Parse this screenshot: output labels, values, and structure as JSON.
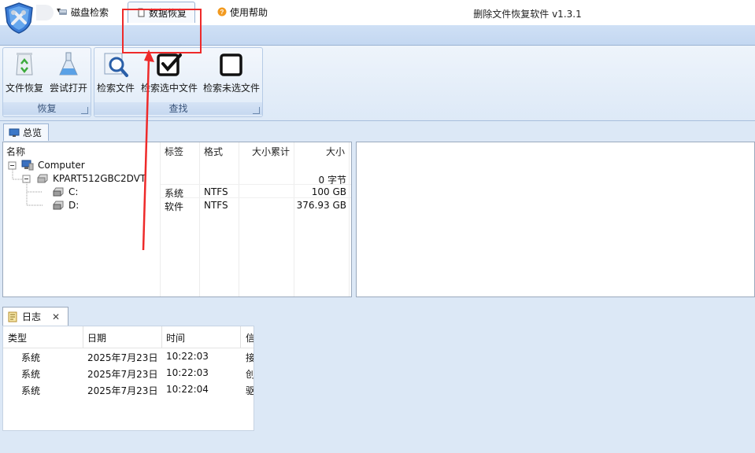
{
  "window": {
    "title": "删除文件恢复软件 v1.3.1"
  },
  "quick_access": {
    "dropdown_glyph": "▾"
  },
  "tabs": [
    {
      "label": "磁盘检索",
      "icon": "disk-icon"
    },
    {
      "label": "数据恢复",
      "icon": "page-icon",
      "active": true
    },
    {
      "label": "使用帮助",
      "icon": "help-icon"
    }
  ],
  "ribbon": {
    "recover_group": {
      "label": "恢复",
      "buttons": [
        {
          "label": "文件恢复",
          "icon": "recycle-icon"
        },
        {
          "label": "尝试打开",
          "icon": "flask-icon"
        }
      ]
    },
    "find_group": {
      "label": "查找",
      "buttons": [
        {
          "label": "检索文件",
          "icon": "magnifier-icon"
        },
        {
          "label": "检索选中文件",
          "icon": "checked-box-icon"
        },
        {
          "label": "检索未选文件",
          "icon": "empty-box-icon"
        }
      ]
    }
  },
  "overview_tab": {
    "label": "总览"
  },
  "tree_table": {
    "columns": {
      "name": "名称",
      "tag": "标签",
      "format": "格式",
      "size_total": "大小累计",
      "size": "大小"
    },
    "rows": [
      {
        "name": "Computer",
        "tag": "",
        "format": "",
        "size_total": "",
        "size": ""
      },
      {
        "name": "KPART512GBC2DVT",
        "tag": "",
        "format": "",
        "size_total": "",
        "size": "0 字节"
      },
      {
        "name": "C:",
        "tag": "系统",
        "format": "NTFS",
        "size_total": "",
        "size": "100 GB"
      },
      {
        "name": "D:",
        "tag": "软件",
        "format": "NTFS",
        "size_total": "",
        "size": "376.93 GB"
      }
    ]
  },
  "log": {
    "tab_label": "日志",
    "close_glyph": "✕",
    "columns": {
      "type": "类型",
      "date": "日期",
      "time": "时间",
      "info": "信"
    },
    "rows": [
      {
        "type": "系统",
        "date": "2025年7月23日",
        "time": "10:22:03",
        "info": "接"
      },
      {
        "type": "系统",
        "date": "2025年7月23日",
        "time": "10:22:03",
        "info": "创"
      },
      {
        "type": "系统",
        "date": "2025年7月23日",
        "time": "10:22:04",
        "info": "驱"
      }
    ]
  },
  "colors": {
    "highlight": "#ee2a2a",
    "ribbon_bg": "#dde9f7",
    "workspace_bg": "#dce8f6"
  }
}
